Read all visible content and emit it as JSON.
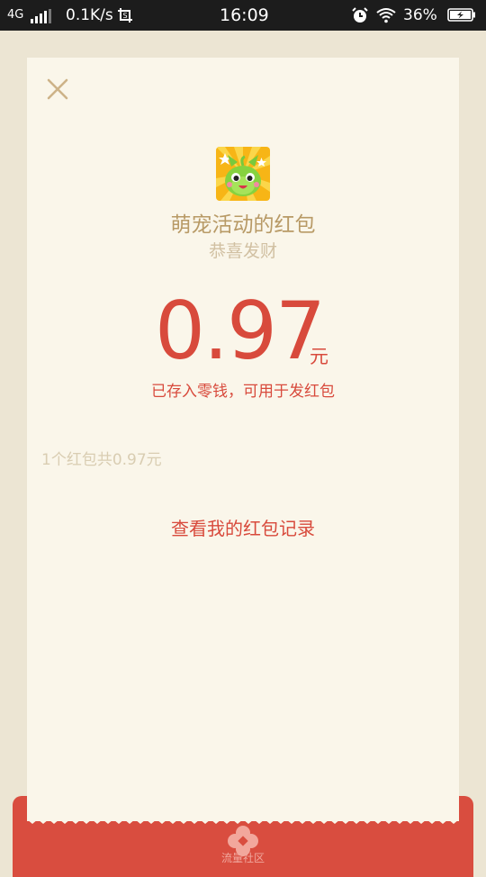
{
  "status_bar": {
    "network": "4G",
    "speed": "0.1K/s",
    "time": "16:09",
    "battery_percent": "36%"
  },
  "red_packet": {
    "sender": "萌宠活动的红包",
    "greeting": "恭喜发财",
    "amount": "0.97",
    "unit": "元",
    "deposit_note": "已存入零钱，可用于发红包",
    "summary": "1个红包共0.97元",
    "records_link": "查看我的红包记录"
  },
  "footer": {
    "emblem_text": "流量社区"
  },
  "colors": {
    "accent_red": "#d84a3c",
    "paper": "#faf6ea",
    "gold_text": "#b89a66",
    "background": "#ece5d3"
  },
  "icons": {
    "close": "close-icon",
    "avatar": "pet-avatar",
    "alarm": "alarm-icon",
    "wifi": "wifi-icon",
    "battery": "battery-charging-icon",
    "screenshot": "screenshot-icon",
    "signal": "signal-icon"
  }
}
